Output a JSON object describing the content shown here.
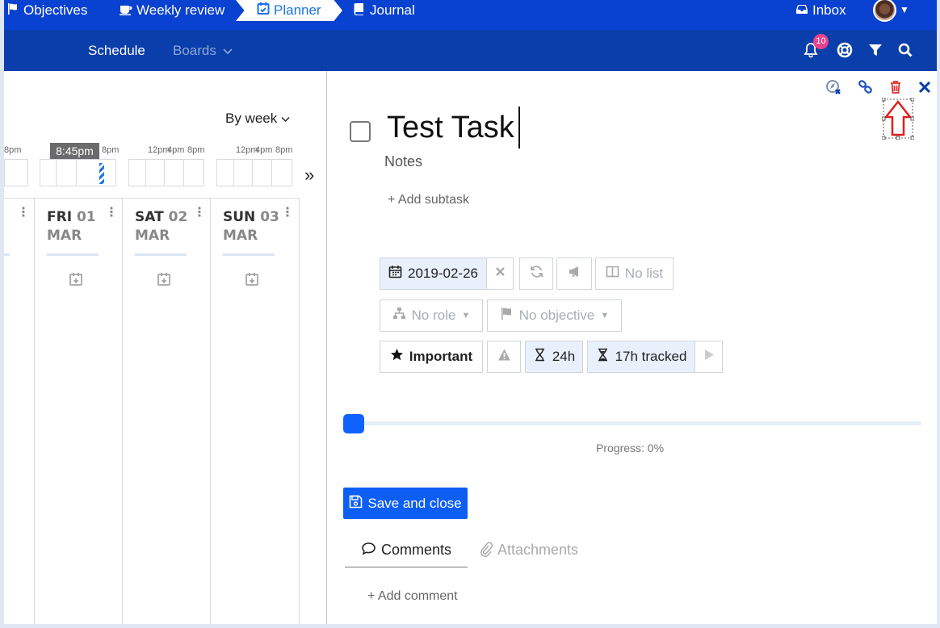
{
  "topnav": {
    "objectives": "Objectives",
    "weekly_review": "Weekly review",
    "planner": "Planner",
    "journal": "Journal",
    "inbox": "Inbox",
    "color": "#0941d1"
  },
  "subnav": {
    "schedule": "Schedule",
    "boards": "Boards",
    "notification_count": "10",
    "color": "#0a3eaa"
  },
  "calendar": {
    "view_select": "By week",
    "current_time": "8:45pm",
    "time_labels": [
      "8pm",
      "8pm",
      "12pm",
      "4pm",
      "8pm",
      "12pm",
      "4pm",
      "8pm"
    ],
    "days": [
      {
        "dow": "FRI",
        "num": "01",
        "mon": "MAR"
      },
      {
        "dow": "SAT",
        "num": "02",
        "mon": "MAR"
      },
      {
        "dow": "SUN",
        "num": "03",
        "mon": "MAR"
      }
    ]
  },
  "task": {
    "title": "Test Task",
    "notes_placeholder": "Notes",
    "add_subtask": "+ Add subtask",
    "date": "2019-02-26",
    "list": "No list",
    "role": "No role",
    "objective": "No objective",
    "priority": "Important",
    "estimate": "24h",
    "tracked": "17h tracked",
    "progress_value": 0,
    "progress_label": "Progress: 0%",
    "save_label": "Save and close"
  },
  "tabs": {
    "comments": "Comments",
    "attachments": "Attachments",
    "add_comment": "+ Add comment"
  },
  "colors": {
    "accent": "#0d5ef5",
    "delete_icon": "#e03131",
    "annotation_arrow": "#e02020"
  }
}
